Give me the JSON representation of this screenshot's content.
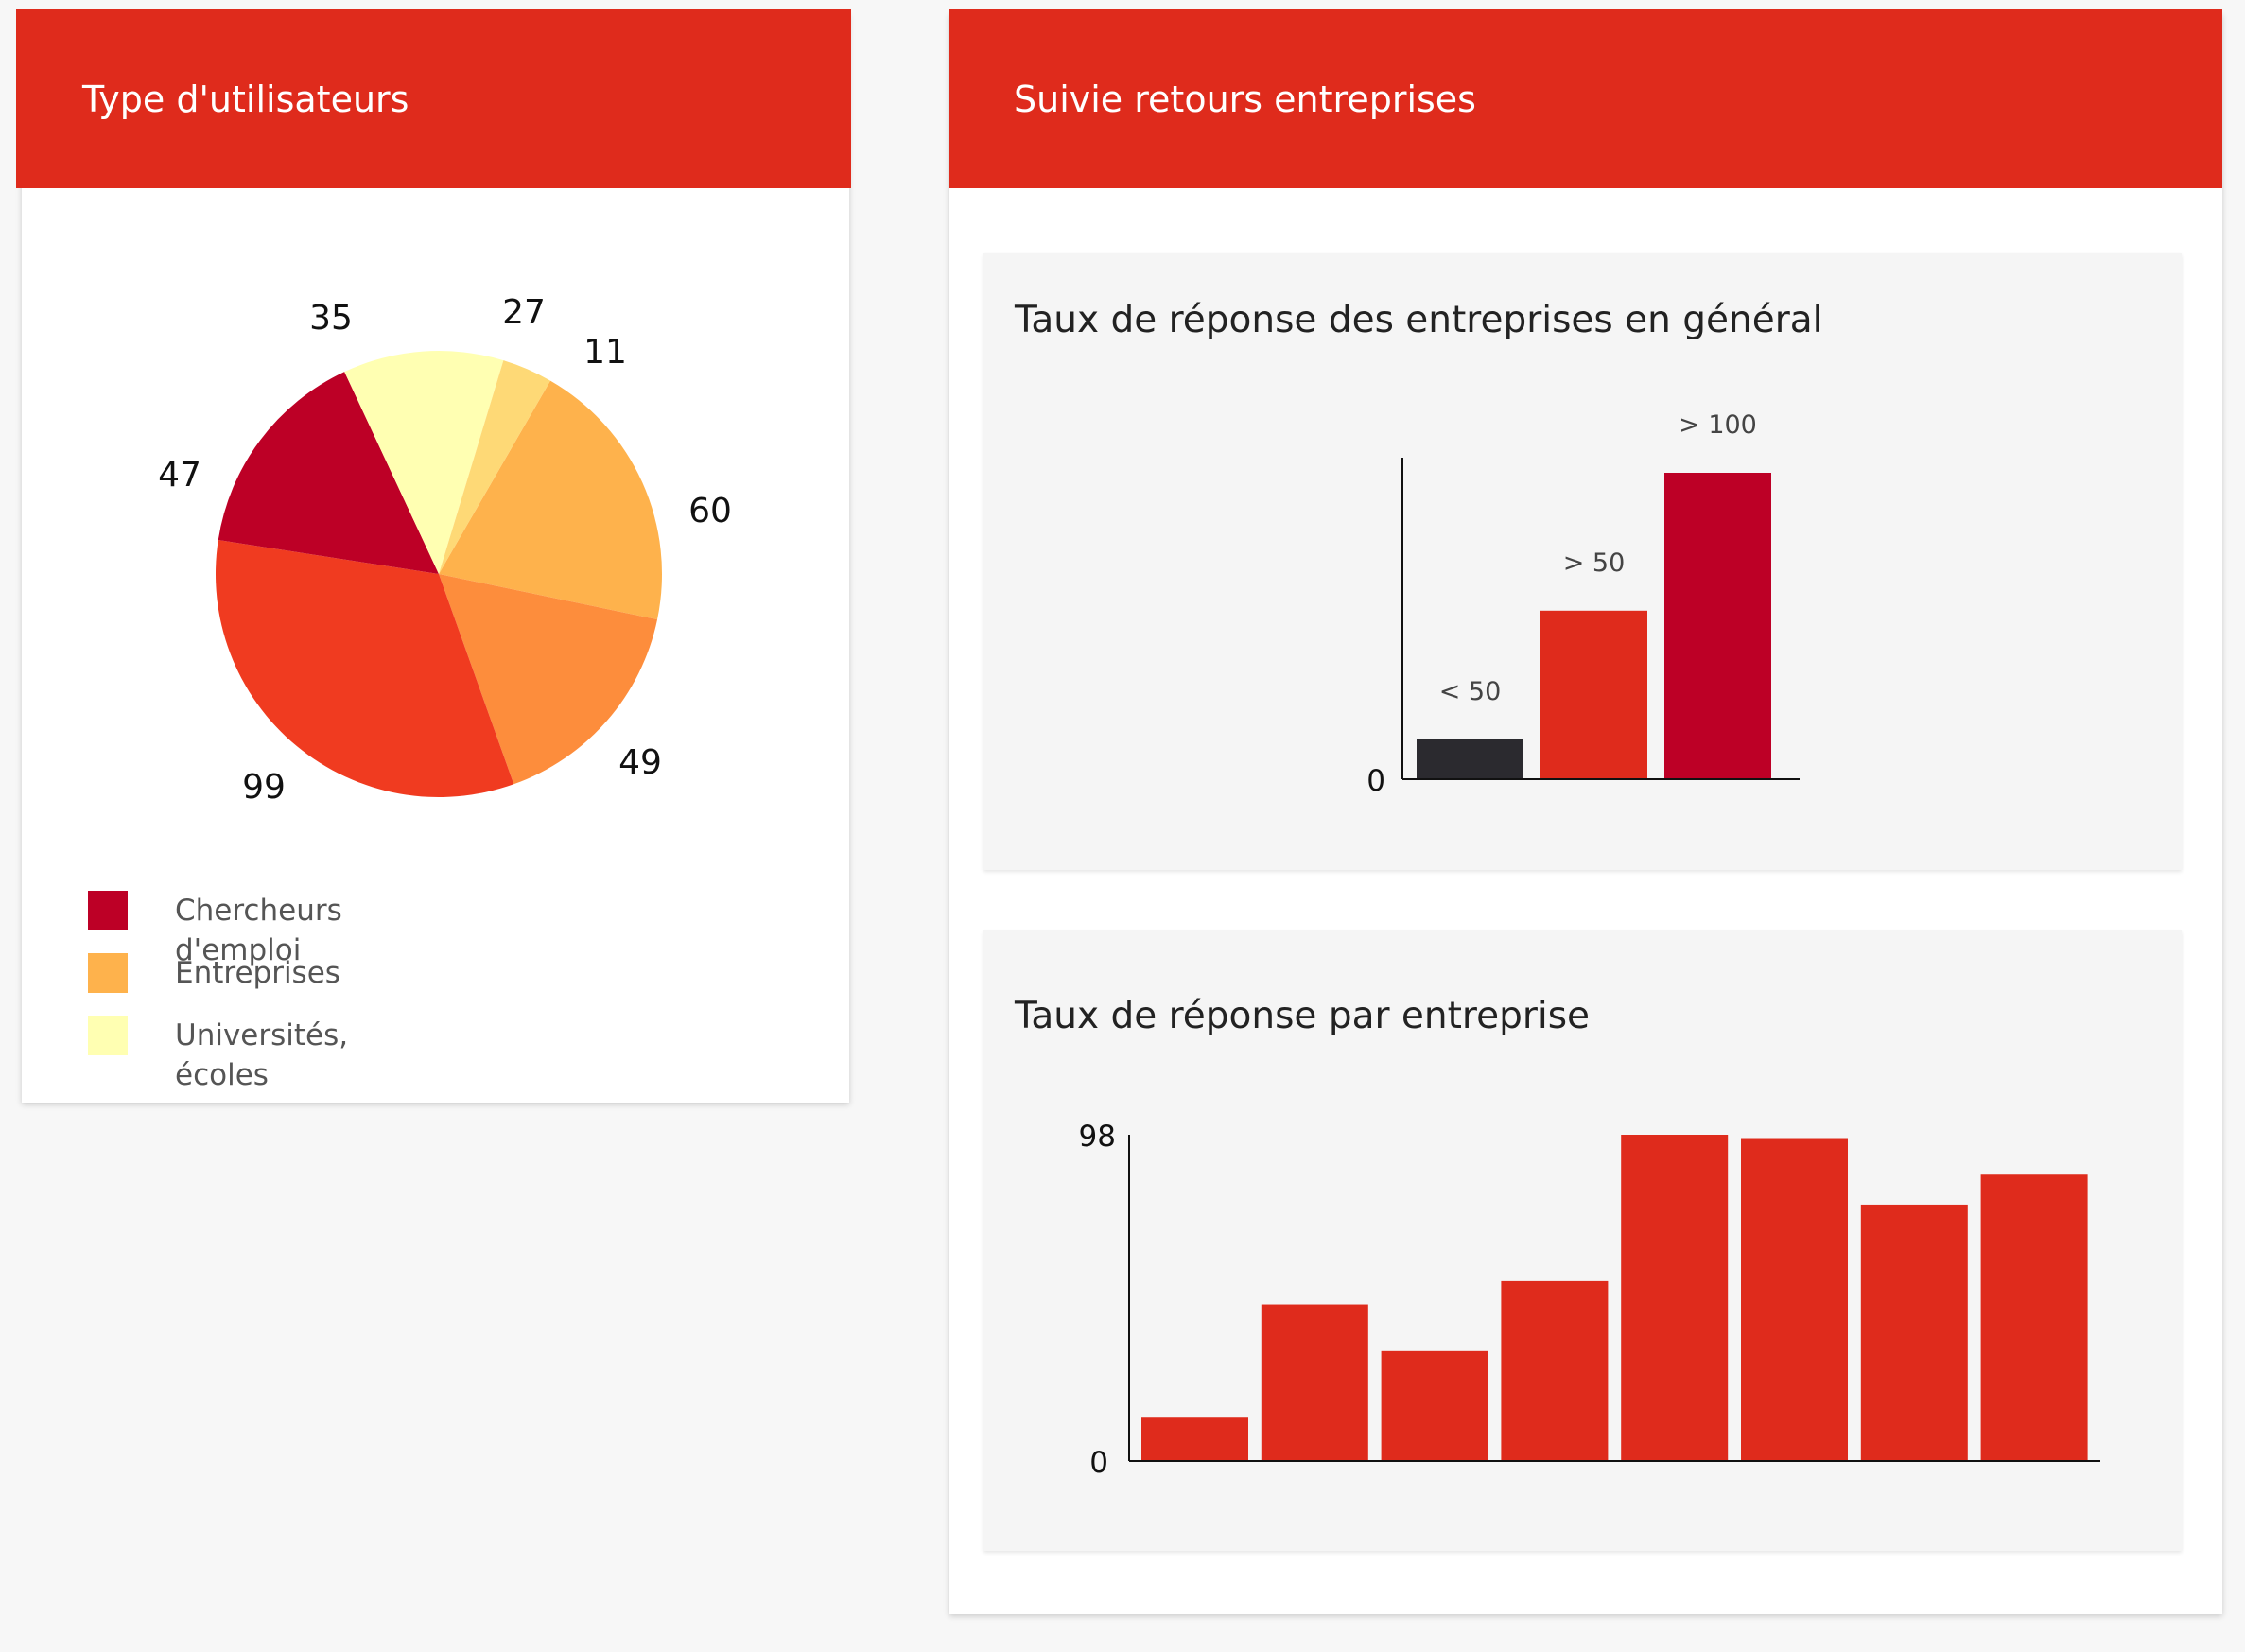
{
  "users_card": {
    "title": "Type d'utilisateurs"
  },
  "companies_card": {
    "title": "Suivie retours entreprises"
  },
  "legend": [
    {
      "label": "Chercheurs d'emploi",
      "color": "#bd0026"
    },
    {
      "label": "Entreprises",
      "color": "#feb24c"
    },
    {
      "label": "Universités, écoles",
      "color": "#ffffb2"
    }
  ],
  "chart_data": [
    {
      "type": "pie",
      "values": [
        60,
        49,
        99,
        47,
        35,
        11
      ],
      "labels": [
        "60",
        "49",
        "99",
        "47",
        "35",
        "11"
      ],
      "outer_labels": [
        "60",
        "49",
        "99",
        "47",
        "35",
        "27",
        "11"
      ],
      "colors": [
        "#feb24c",
        "#fd8d3c",
        "#f03b20",
        "#bd0026",
        "#ffffb2",
        "#fed976"
      ]
    },
    {
      "type": "bar",
      "title": "Taux de réponse des entreprises en général",
      "categories": [
        "< 50",
        "> 50",
        "> 100"
      ],
      "values": [
        13,
        55,
        100
      ],
      "colors": [
        "#2b2a2f",
        "#df2b1c",
        "#bd0026"
      ],
      "y_tick_labels": [
        "0"
      ],
      "ylim": [
        0,
        100
      ]
    },
    {
      "type": "bar",
      "title": "Taux de réponse par entreprise",
      "values": [
        13,
        47,
        33,
        54,
        98,
        97,
        77,
        86
      ],
      "color": "#df2b1c",
      "y_tick_labels": [
        "0",
        "98"
      ],
      "ylim": [
        0,
        98
      ]
    }
  ]
}
